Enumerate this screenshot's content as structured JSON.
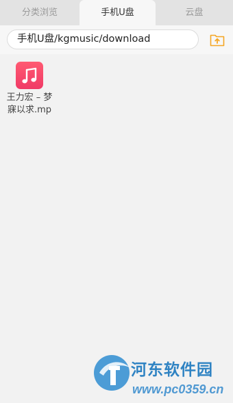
{
  "tabs": {
    "left": "分类浏览",
    "active": "手机U盘",
    "right": "云盘"
  },
  "path_bar": {
    "value": "手机U盘/kgmusic/download"
  },
  "files": [
    {
      "name": "王力宏 – 梦寐以求.mp",
      "icon": "music-file-icon"
    }
  ],
  "watermark": {
    "title": "河东软件园",
    "url": "www.pc0359.cn"
  },
  "colors": {
    "accent": "#f5a623",
    "music_icon": "#f03a66",
    "watermark": "#2f83c3"
  }
}
